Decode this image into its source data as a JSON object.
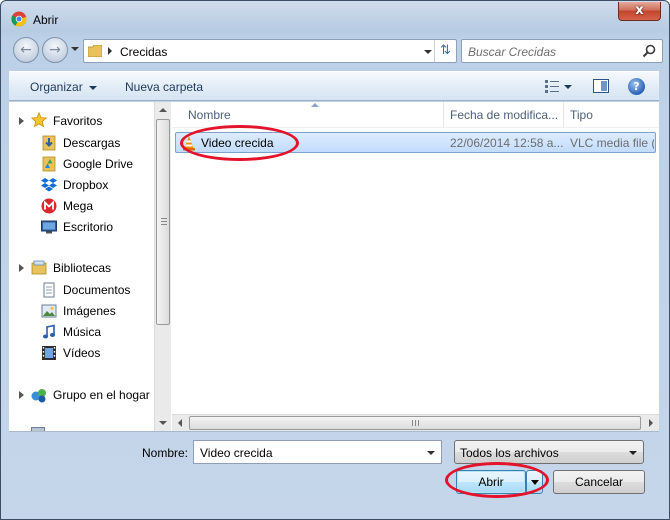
{
  "window": {
    "title": "Abrir",
    "close_label": "x"
  },
  "nav": {
    "back_label": "←",
    "forward_label": "→",
    "address": "Crecidas",
    "refresh_label": "⇅",
    "search_placeholder": "Buscar Crecidas"
  },
  "toolbar": {
    "organize_label": "Organizar",
    "new_folder_label": "Nueva carpeta",
    "help_label": "?"
  },
  "sidebar": {
    "favorites": {
      "label": "Favoritos",
      "items": [
        {
          "label": "Descargas",
          "icon": "downloads-icon"
        },
        {
          "label": "Google Drive",
          "icon": "google-drive-icon"
        },
        {
          "label": "Dropbox",
          "icon": "dropbox-icon"
        },
        {
          "label": "Mega",
          "icon": "mega-icon"
        },
        {
          "label": "Escritorio",
          "icon": "desktop-icon"
        }
      ]
    },
    "libraries": {
      "label": "Bibliotecas",
      "items": [
        {
          "label": "Documentos",
          "icon": "documents-icon"
        },
        {
          "label": "Imágenes",
          "icon": "pictures-icon"
        },
        {
          "label": "Música",
          "icon": "music-icon"
        },
        {
          "label": "Vídeos",
          "icon": "videos-icon"
        }
      ]
    },
    "homegroup": {
      "label": "Grupo en el hogar"
    }
  },
  "files": {
    "columns": [
      "Nombre",
      "Fecha de modifica...",
      "Tipo"
    ],
    "rows": [
      {
        "name": "Video crecida",
        "date": "22/06/2014 12:58 a...",
        "type": "VLC media file (.f"
      }
    ]
  },
  "footer": {
    "filename_label": "Nombre:",
    "filename_value": "Video crecida",
    "filter_value": "Todos los archivos",
    "open_label": "Abrir",
    "cancel_label": "Cancelar"
  },
  "colors": {
    "annotation": "#e3132b",
    "selection": "#c2dcfd",
    "window_frame": "#bcd0e7"
  }
}
